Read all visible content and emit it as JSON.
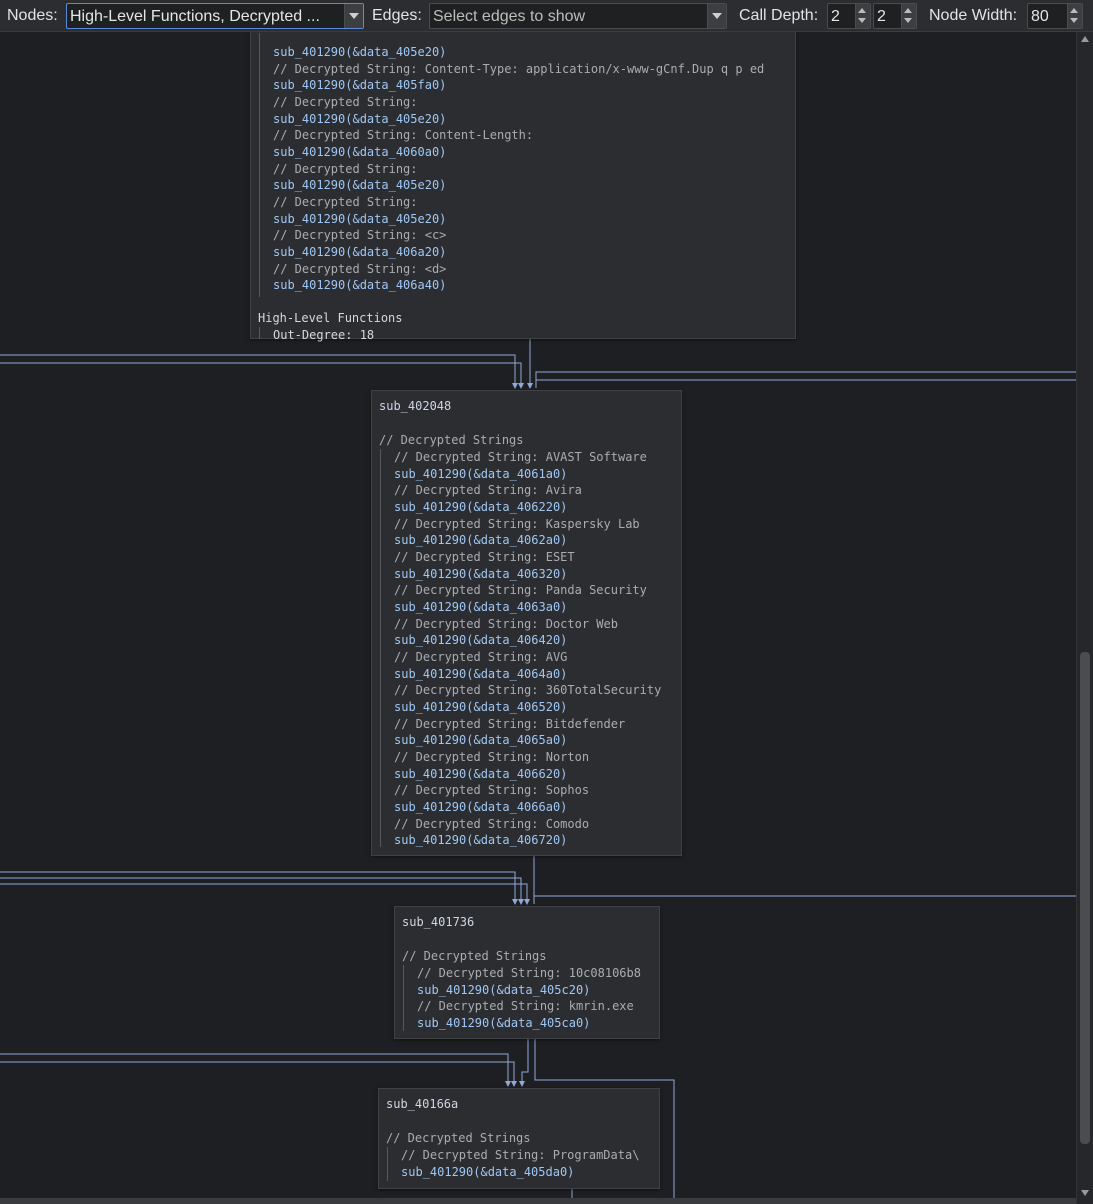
{
  "toolbar": {
    "nodes_label": "Nodes:",
    "nodes_value": "High-Level Functions, Decrypted ...",
    "edges_label": "Edges:",
    "edges_placeholder": "Select edges to show",
    "call_depth_label": "Call Depth:",
    "call_depth_min": "2",
    "call_depth_max": "2",
    "node_width_label": "Node Width:",
    "node_width_value": "80"
  },
  "nodes": {
    "top": {
      "lines": [
        "sub_401290(&data_405e20)",
        "// Decrypted String: Content-Type: application/x-www-gCnf.Dup q p ed",
        "sub_401290(&data_405fa0)",
        "// Decrypted String:",
        "sub_401290(&data_405e20)",
        "// Decrypted String: Content-Length:",
        "sub_401290(&data_4060a0)",
        "// Decrypted String:",
        "sub_401290(&data_405e20)",
        "// Decrypted String:",
        "sub_401290(&data_405e20)",
        "// Decrypted String: <c>",
        "sub_401290(&data_406a20)",
        "// Decrypted String: <d>",
        "sub_401290(&data_406a40)"
      ],
      "footer_title": "High-Level Functions",
      "footer_value": "Out-Degree: 18"
    },
    "n402048": {
      "title": "sub_402048",
      "section": "// Decrypted Strings",
      "lines": [
        "// Decrypted String: AVAST Software",
        "sub_401290(&data_4061a0)",
        "// Decrypted String: Avira",
        "sub_401290(&data_406220)",
        "// Decrypted String: Kaspersky Lab",
        "sub_401290(&data_4062a0)",
        "// Decrypted String: ESET",
        "sub_401290(&data_406320)",
        "// Decrypted String: Panda Security",
        "sub_401290(&data_4063a0)",
        "// Decrypted String: Doctor Web",
        "sub_401290(&data_406420)",
        "// Decrypted String: AVG",
        "sub_401290(&data_4064a0)",
        "// Decrypted String: 360TotalSecurity",
        "sub_401290(&data_406520)",
        "// Decrypted String: Bitdefender",
        "sub_401290(&data_4065a0)",
        "// Decrypted String: Norton",
        "sub_401290(&data_406620)",
        "// Decrypted String: Sophos",
        "sub_401290(&data_4066a0)",
        "// Decrypted String: Comodo",
        "sub_401290(&data_406720)"
      ]
    },
    "n401736": {
      "title": "sub_401736",
      "section": "// Decrypted Strings",
      "lines": [
        "// Decrypted String: 10c08106b8",
        "sub_401290(&data_405c20)",
        "// Decrypted String: kmrin.exe",
        "sub_401290(&data_405ca0)"
      ]
    },
    "n40166a": {
      "title": "sub_40166a",
      "section": "// Decrypted Strings",
      "lines": [
        "// Decrypted String: ProgramData\\",
        "sub_401290(&data_405da0)"
      ]
    }
  },
  "colors": {
    "background": "#1e1f22",
    "node_bg": "#2b2d30",
    "edge": "#8fa8d8",
    "call_text": "#9fc7f5",
    "comment_text": "#a9acb1"
  }
}
